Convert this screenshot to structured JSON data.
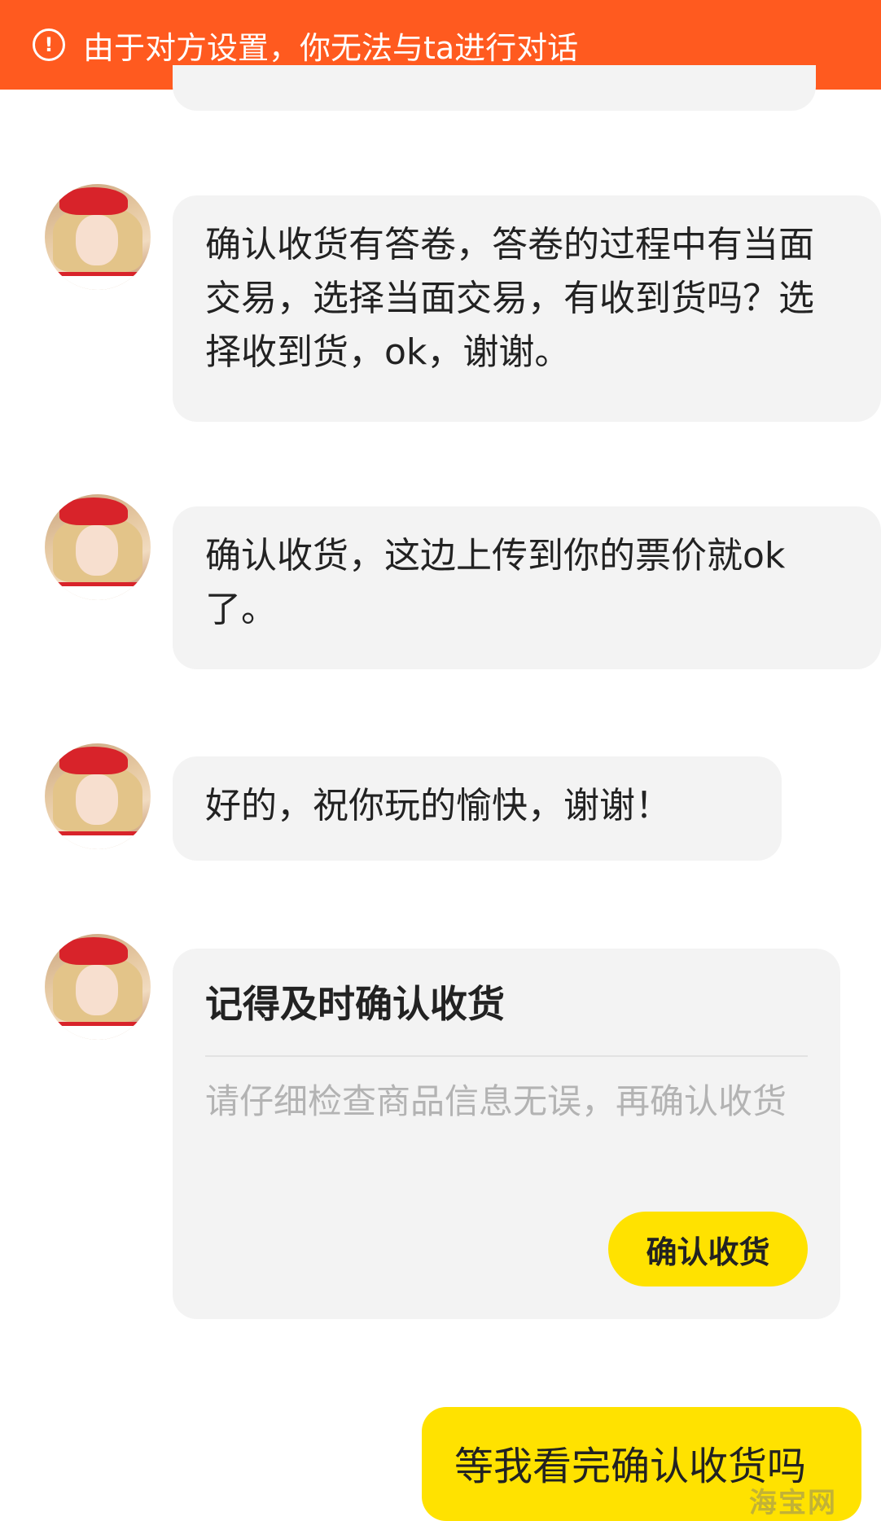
{
  "banner": {
    "icon": "warning-circle-icon",
    "text": "由于对方设置，你无法与ta进行对话",
    "color": "#ff5a1f"
  },
  "messages": [
    {
      "text": "确认收货有答卷，答卷的过程中有当面交易，选择当面交易，有收到货吗？选择收到货，ok，谢谢。"
    },
    {
      "text": "确认收货，这边上传到你的票价就ok了。"
    },
    {
      "text": "好的，祝你玩的愉快，谢谢！"
    }
  ],
  "card": {
    "title": "记得及时确认收货",
    "body": "请仔细检查商品信息无误，再确认收货",
    "button_label": "确认收货"
  },
  "self_message": {
    "text": "等我看完确认收货吗"
  },
  "watermark": {
    "text": "海宝网"
  },
  "colors": {
    "accent_yellow": "#ffe200",
    "bubble_gray": "#f3f3f3"
  }
}
